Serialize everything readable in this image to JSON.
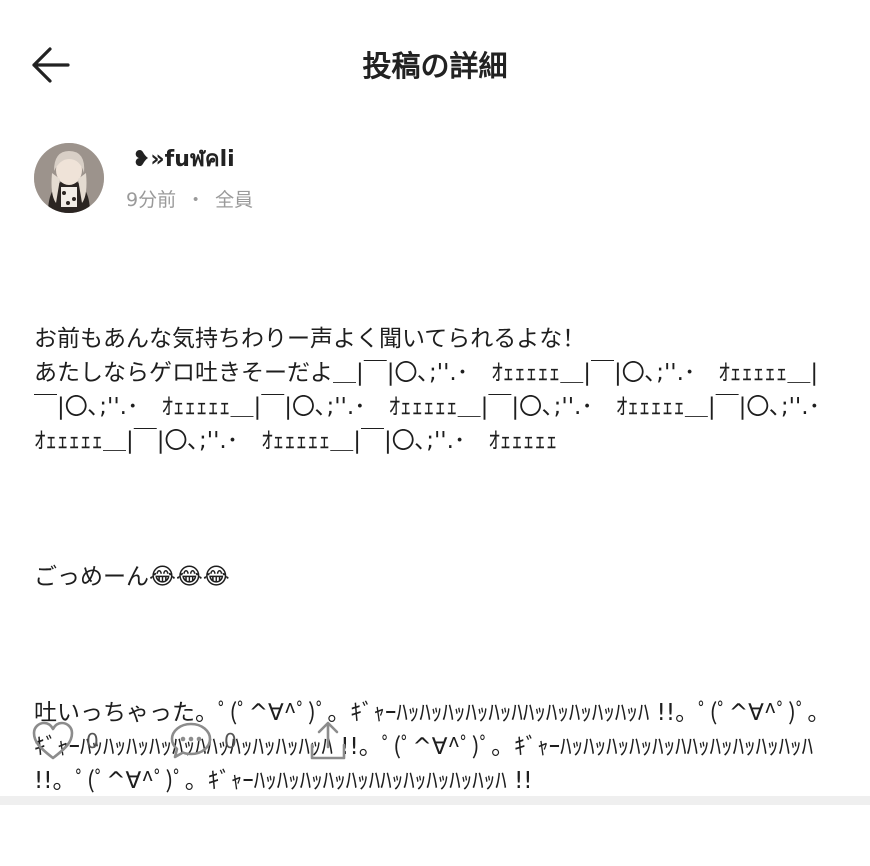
{
  "header": {
    "title": "投稿の詳細",
    "back_icon": "arrow-left-icon"
  },
  "author": {
    "name": "❥»fuฬคli",
    "time": "9分前",
    "separator": "・",
    "audience": "全員"
  },
  "post": {
    "paragraph1": "お前もあんな気持ちわりー声よく聞いてられるよな！\nあたしならゲロ吐きそーだよ＿|￣|〇､;''.･　ｵｪｪｪｪｪ＿|￣|〇､;''.･　ｵｪｪｪｪｪ＿|￣|〇､;''.･　ｵｪｪｪｪｪ＿|￣|〇､;''.･　ｵｪｪｪｪｪ＿|￣|〇､;''.･　ｵｪｪｪｪｪ＿|￣|〇､;''.･　ｵｪｪｪｪｪ＿|￣|〇､;''.･　ｵｪｪｪｪｪ＿|￣|〇､;''.･　ｵｪｪｪｪｪ",
    "paragraph2": "ごっめーん😂😂😂",
    "paragraph3": "吐いっちゃった。ﾟ(ﾟ^∀^ﾟ)ﾟ。ｷﾞｬｰﾊｯﾊｯﾊｯﾊｯﾊｯﾊﾊｯﾊｯﾊｯﾊｯﾊｯﾊ !!。ﾟ(ﾟ^∀^ﾟ)ﾟ。ｷﾞｬｰﾊｯﾊｯﾊｯﾊｯﾊｯﾊﾊｯﾊｯﾊｯﾊｯﾊｯﾊ !!。ﾟ(ﾟ^∀^ﾟ)ﾟ。ｷﾞｬｰﾊｯﾊｯﾊｯﾊｯﾊｯﾊﾊｯﾊｯﾊｯﾊｯﾊｯﾊ !!。ﾟ(ﾟ^∀^ﾟ)ﾟ。ｷﾞｬｰﾊｯﾊｯﾊｯﾊｯﾊｯﾊﾊｯﾊｯﾊｯﾊｯﾊｯﾊ !!"
  },
  "actions": {
    "like_count": "0",
    "comment_count": "0",
    "like_icon": "heart-icon",
    "comment_icon": "comment-bubble-icon",
    "share_icon": "share-upload-icon"
  },
  "colors": {
    "text": "#1e1e1e",
    "muted": "#9a9a9a",
    "icon": "#8c8c8c"
  }
}
